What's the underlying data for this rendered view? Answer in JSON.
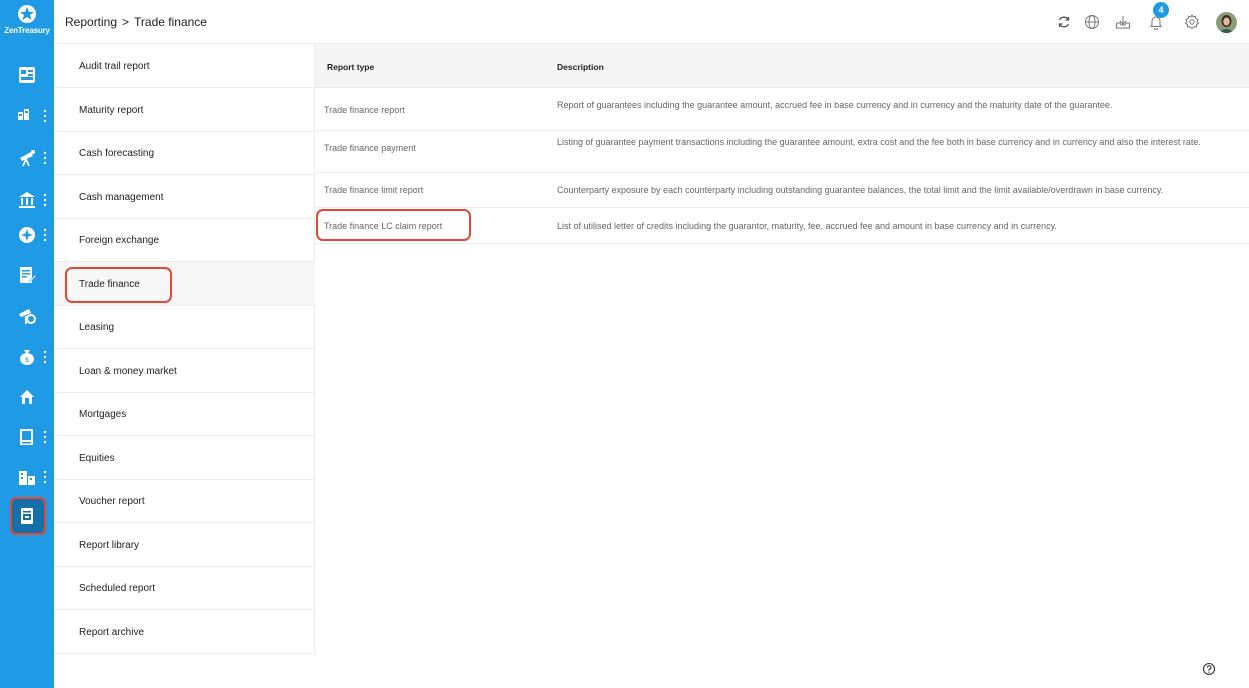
{
  "app": {
    "brand_name": "ZenTreasury",
    "accent_color": "#1e9be4",
    "highlight_color": "#e34a35"
  },
  "rail": {
    "items": [
      {
        "icon": "dashboard-icon",
        "has_menu": false
      },
      {
        "icon": "accounts-icon",
        "has_menu": true
      },
      {
        "icon": "forecast-telescope-icon",
        "has_menu": true
      },
      {
        "icon": "bank-icon",
        "has_menu": true
      },
      {
        "icon": "navigation-icon",
        "has_menu": true
      },
      {
        "icon": "document-edit-icon",
        "has_menu": false
      },
      {
        "icon": "trade-icon",
        "has_menu": false
      },
      {
        "icon": "money-bag-icon",
        "has_menu": true
      },
      {
        "icon": "property-icon",
        "has_menu": false
      },
      {
        "icon": "ledger-icon",
        "has_menu": true
      },
      {
        "icon": "buildings-icon",
        "has_menu": true
      },
      {
        "icon": "reporting-icon",
        "has_menu": false,
        "active": true
      }
    ]
  },
  "header": {
    "breadcrumb": [
      "Reporting",
      "Trade finance"
    ],
    "breadcrumb_separator": ">",
    "notification_count": "4",
    "icons": [
      "refresh-icon",
      "globe-icon",
      "download-tray-icon",
      "bell-icon",
      "gear-icon",
      "avatar"
    ]
  },
  "submenu": {
    "items": [
      {
        "label": "Audit trail report"
      },
      {
        "label": "Maturity report"
      },
      {
        "label": "Cash forecasting"
      },
      {
        "label": "Cash management"
      },
      {
        "label": "Foreign exchange"
      },
      {
        "label": "Trade finance",
        "selected": true
      },
      {
        "label": "Leasing"
      },
      {
        "label": "Loan & money market"
      },
      {
        "label": "Mortgages"
      },
      {
        "label": "Equities"
      },
      {
        "label": "Voucher report"
      },
      {
        "label": "Report library"
      },
      {
        "label": "Scheduled report"
      },
      {
        "label": "Report archive"
      }
    ]
  },
  "table": {
    "columns": [
      "Report type",
      "Description"
    ],
    "rows": [
      {
        "type": "Trade finance report",
        "description": "Report of guarantees including the guarantee amount, accrued fee in base currency and in currency and the maturity date of the guarantee."
      },
      {
        "type": "Trade finance payment",
        "description": "Listing of guarantee payment transactions including the guarantee amount, extra cost and the fee both in base currency and in currency and also the interest rate."
      },
      {
        "type": "Trade finance limit report",
        "description": "Counterparty exposure by each counterparty including outstanding guarantee balances, the total limit and the limit available/overdrawn in base currency."
      },
      {
        "type": "Trade finance LC claim report",
        "description": "List of utilised letter of credits including the guarantor, maturity, fee, accrued fee and amount in base currency and in currency.",
        "highlighted": true
      }
    ]
  }
}
